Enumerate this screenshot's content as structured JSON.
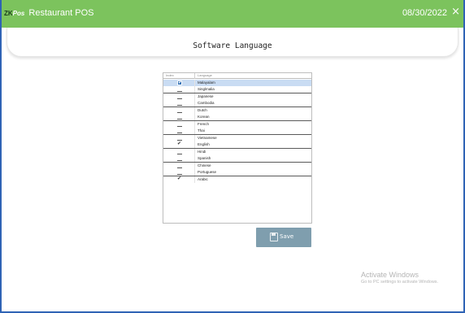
{
  "app": {
    "logo_mark": "ZK",
    "logo_suffix": "Pos",
    "title": "Restaurant POS",
    "date": "08/30/2022",
    "close_glyph": "×"
  },
  "page": {
    "title": "Software Language"
  },
  "table": {
    "headers": {
      "index": "Index",
      "language": "Language"
    },
    "rows": [
      {
        "name": "Malayalam",
        "checked": true,
        "selected": true
      },
      {
        "name": "Singlmalia",
        "checked": false,
        "selected": false
      },
      {
        "name": "Japanese",
        "checked": false,
        "selected": false
      },
      {
        "name": "Cambodia",
        "checked": false,
        "selected": false
      },
      {
        "name": "Dutch",
        "checked": false,
        "selected": false
      },
      {
        "name": "Korean",
        "checked": false,
        "selected": false
      },
      {
        "name": "French",
        "checked": false,
        "selected": false
      },
      {
        "name": "Thai",
        "checked": false,
        "selected": false
      },
      {
        "name": "Vietnamese",
        "checked": false,
        "selected": false
      },
      {
        "name": "English",
        "checked": true,
        "selected": false
      },
      {
        "name": "Hindi",
        "checked": false,
        "selected": false
      },
      {
        "name": "Spanish",
        "checked": false,
        "selected": false
      },
      {
        "name": "Chinese",
        "checked": false,
        "selected": false
      },
      {
        "name": "Portuguese",
        "checked": false,
        "selected": false
      },
      {
        "name": "Arabic",
        "checked": true,
        "selected": false
      }
    ]
  },
  "actions": {
    "save_label": "Save"
  },
  "watermark": {
    "title": "Activate Windows",
    "subtitle": "Go to PC settings to activate Windows."
  },
  "colors": {
    "titlebar": "#7cc35d",
    "save_button": "#7f9eae",
    "selected_row": "#c9dcf3",
    "window_border": "#2f63b5"
  }
}
